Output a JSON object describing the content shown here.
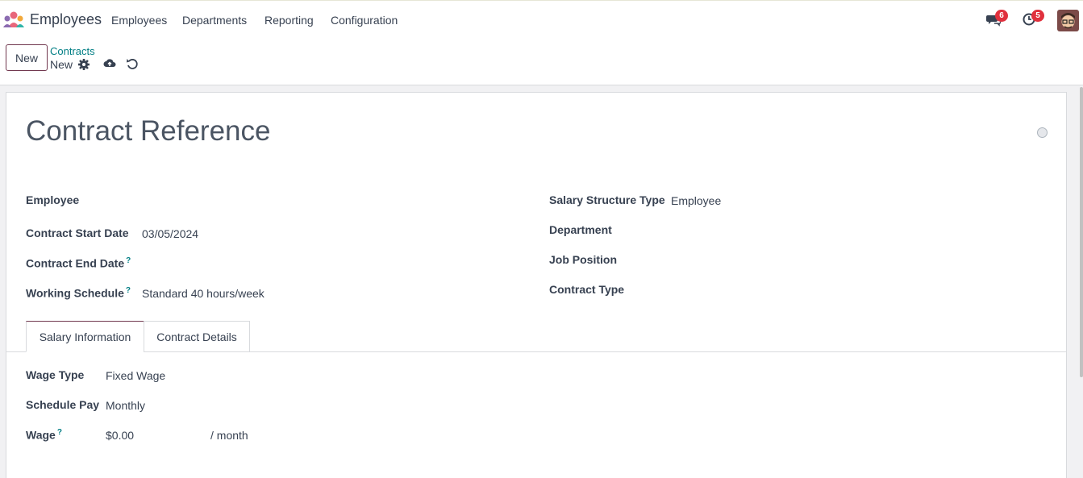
{
  "navbar": {
    "app_name": "Employees",
    "menu": [
      "Employees",
      "Departments",
      "Reporting",
      "Configuration"
    ],
    "messages_count": "6",
    "activities_count": "5",
    "icons": {
      "app": "employees-app-icon",
      "messages": "chat-icon",
      "activities": "clock-icon",
      "user": "avatar"
    }
  },
  "control_panel": {
    "new_label": "New",
    "breadcrumb_parent": "Contracts",
    "breadcrumb_current": "New",
    "icons": [
      "gear-icon",
      "cloud-upload-icon",
      "undo-icon"
    ]
  },
  "form": {
    "title_placeholder": "Contract Reference",
    "left": {
      "employee_label": "Employee",
      "start_label": "Contract Start Date",
      "start_value": "03/05/2024",
      "end_label": "Contract End Date",
      "schedule_label": "Working Schedule",
      "schedule_value": "Standard 40 hours/week"
    },
    "right": {
      "structure_label": "Salary Structure Type",
      "structure_value": "Employee",
      "department_label": "Department",
      "job_label": "Job Position",
      "contract_type_label": "Contract Type"
    },
    "help_mark": "?"
  },
  "tabs": {
    "salary": "Salary Information",
    "details": "Contract Details",
    "active": "Salary Information"
  },
  "salary": {
    "wage_type_label": "Wage Type",
    "wage_type_value": "Fixed Wage",
    "schedule_pay_label": "Schedule Pay",
    "schedule_pay_value": "Monthly",
    "wage_label": "Wage",
    "wage_value": "$0.00",
    "wage_suffix": "/ month"
  },
  "colors": {
    "brand": "#71384f",
    "link": "#017e84",
    "badge": "#e0303d"
  }
}
